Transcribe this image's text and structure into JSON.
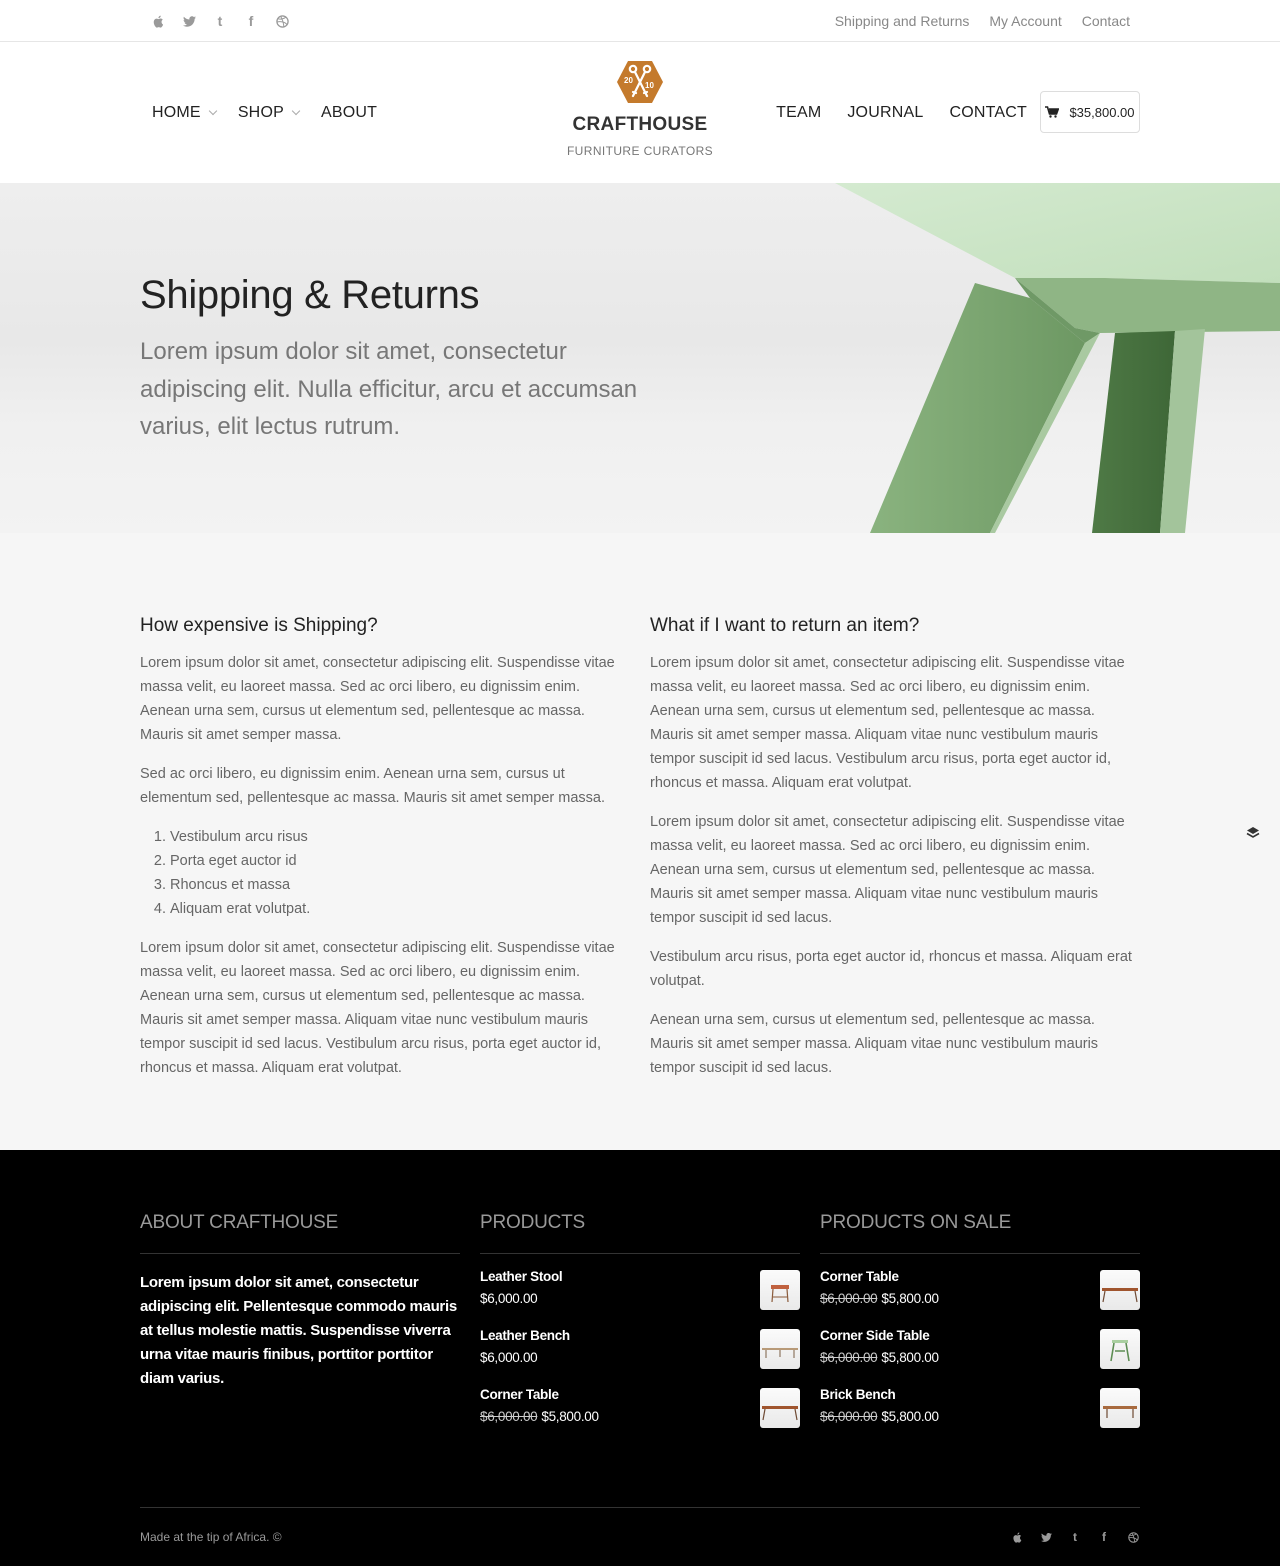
{
  "topbar": {
    "social": [
      {
        "icon": "apple-icon",
        "glyph": ""
      },
      {
        "icon": "twitter-icon",
        "glyph": "🐦"
      },
      {
        "icon": "tumblr-icon",
        "glyph": "t"
      },
      {
        "icon": "facebook-icon",
        "glyph": "f"
      },
      {
        "icon": "dribbble-icon",
        "glyph": "◎"
      }
    ],
    "links": [
      "Shipping and Returns",
      "My Account",
      "Contact"
    ]
  },
  "header": {
    "nav_left": [
      {
        "label": "HOME",
        "dropdown": true
      },
      {
        "label": "SHOP",
        "dropdown": true
      },
      {
        "label": "ABOUT",
        "dropdown": false
      }
    ],
    "logo": {
      "year_left": "20",
      "year_right": "10",
      "name": "CRAFTHOUSE",
      "tagline": "FURNITURE CURATORS",
      "color": "#c47a2c"
    },
    "nav_right": [
      "TEAM",
      "JOURNAL",
      "CONTACT"
    ],
    "cart_total": "$35,800.00"
  },
  "hero": {
    "title": "Shipping & Returns",
    "subtitle": "Lorem ipsum dolor sit amet, consectetur adipiscing elit. Nulla efficitur, arcu et accumsan varius, elit lectus rutrum."
  },
  "content": {
    "left": {
      "heading": "How expensive is Shipping?",
      "p1": "Lorem ipsum dolor sit amet, consectetur adipiscing elit. Suspendisse vitae massa velit, eu laoreet massa. Sed ac orci libero, eu dignissim enim. Aenean urna sem, cursus ut elementum sed, pellentesque ac massa. Mauris sit amet semper massa.",
      "p2": "Sed ac orci libero, eu dignissim enim. Aenean urna sem, cursus ut elementum sed, pellentesque ac massa. Mauris sit amet semper massa.",
      "list": [
        "Vestibulum arcu risus",
        "Porta eget auctor id",
        "Rhoncus et massa",
        "Aliquam erat volutpat."
      ],
      "p3": "Lorem ipsum dolor sit amet, consectetur adipiscing elit. Suspendisse vitae massa velit, eu laoreet massa. Sed ac orci libero, eu dignissim enim. Aenean urna sem, cursus ut elementum sed, pellentesque ac massa. Mauris sit amet semper massa. Aliquam vitae nunc vestibulum mauris tempor suscipit id sed lacus. Vestibulum arcu risus, porta eget auctor id, rhoncus et massa. Aliquam erat volutpat."
    },
    "right": {
      "heading": "What if I want to return an item?",
      "p1": "Lorem ipsum dolor sit amet, consectetur adipiscing elit. Suspendisse vitae massa velit, eu laoreet massa. Sed ac orci libero, eu dignissim enim. Aenean urna sem, cursus ut elementum sed, pellentesque ac massa. Mauris sit amet semper massa. Aliquam vitae nunc vestibulum mauris tempor suscipit id sed lacus. Vestibulum arcu risus, porta eget auctor id, rhoncus et massa. Aliquam erat volutpat.",
      "p2": "Lorem ipsum dolor sit amet, consectetur adipiscing elit. Suspendisse vitae massa velit, eu laoreet massa. Sed ac orci libero, eu dignissim enim. Aenean urna sem, cursus ut elementum sed, pellentesque ac massa. Mauris sit amet semper massa. Aliquam vitae nunc vestibulum mauris tempor suscipit id sed lacus.",
      "p3": "Vestibulum arcu risus, porta eget auctor id, rhoncus et massa. Aliquam erat volutpat.",
      "p4": "Aenean urna sem, cursus ut elementum sed, pellentesque ac massa. Mauris sit amet semper massa. Aliquam vitae nunc vestibulum mauris tempor suscipit id sed lacus."
    }
  },
  "footer": {
    "about": {
      "heading": "ABOUT CRAFTHOUSE",
      "text": "Lorem ipsum dolor sit amet, consectetur adipiscing elit. Pellentesque commodo mauris at tellus molestie mattis. Suspendisse viverra urna vitae mauris finibus, porttitor porttitor diam varius."
    },
    "products": {
      "heading": "PRODUCTS",
      "items": [
        {
          "name": "Leather Stool",
          "old_price": "",
          "price": "$6,000.00",
          "thumb": "stool"
        },
        {
          "name": "Leather Bench",
          "old_price": "",
          "price": "$6,000.00",
          "thumb": "bench"
        },
        {
          "name": "Corner Table",
          "old_price": "$6,000.00",
          "price": "$5,800.00",
          "thumb": "table"
        }
      ]
    },
    "sale": {
      "heading": "PRODUCTS ON SALE",
      "items": [
        {
          "name": "Corner Table",
          "old_price": "$6,000.00",
          "price": "$5,800.00",
          "thumb": "table"
        },
        {
          "name": "Corner Side Table",
          "old_price": "$6,000.00",
          "price": "$5,800.00",
          "thumb": "sidetable"
        },
        {
          "name": "Brick Bench",
          "old_price": "$6,000.00",
          "price": "$5,800.00",
          "thumb": "brick"
        }
      ]
    },
    "made": "Made at the tip of Africa. ©",
    "social": [
      "apple-icon",
      "twitter-icon",
      "tumblr-icon",
      "facebook-icon",
      "dribbble-icon"
    ]
  },
  "colors": {
    "accent": "#c47a2c",
    "hero_table": "#7ea774",
    "footer_bg": "#000000",
    "content_bg": "#f6f6f6"
  }
}
